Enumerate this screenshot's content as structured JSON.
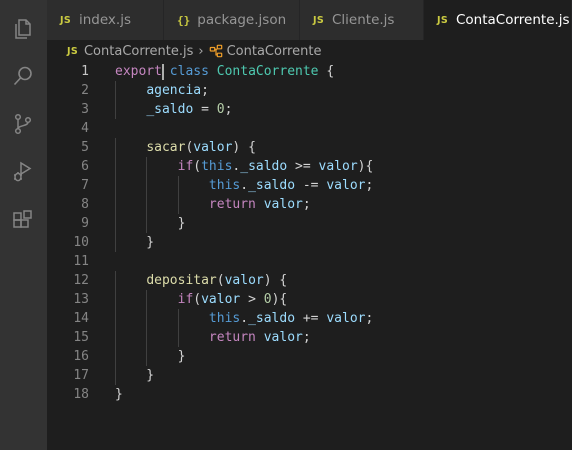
{
  "activity_bar": {
    "items": [
      {
        "icon": "explorer-icon"
      },
      {
        "icon": "search-icon"
      },
      {
        "icon": "source-control-icon"
      },
      {
        "icon": "run-debug-icon"
      },
      {
        "icon": "extensions-icon"
      }
    ]
  },
  "tabs": [
    {
      "label": "index.js",
      "badge": "JS",
      "active": false
    },
    {
      "label": "package.json",
      "badge": "{}",
      "active": false
    },
    {
      "label": "Cliente.js",
      "badge": "JS",
      "active": false
    },
    {
      "label": "ContaCorrente.js",
      "badge": "JS",
      "active": true,
      "close": "✕"
    }
  ],
  "breadcrumb": {
    "file_badge": "JS",
    "file": "ContaCorrente.js",
    "separator": "›",
    "symbol": "ContaCorrente"
  },
  "editor": {
    "current_line": 1,
    "line_numbers": [
      "1",
      "2",
      "3",
      "4",
      "5",
      "6",
      "7",
      "8",
      "9",
      "10",
      "11",
      "12",
      "13",
      "14",
      "15",
      "16",
      "17",
      "18"
    ],
    "lines": [
      [
        {
          "t": "kw",
          "v": "export"
        },
        {
          "t": "plain",
          "v": " "
        },
        {
          "t": "kw2",
          "v": "class"
        },
        {
          "t": "plain",
          "v": " "
        },
        {
          "t": "cls",
          "v": "ContaCorrente"
        },
        {
          "t": "plain",
          "v": " {"
        }
      ],
      [
        {
          "t": "plain",
          "v": "    "
        },
        {
          "t": "prop",
          "v": "agencia"
        },
        {
          "t": "plain",
          "v": ";"
        }
      ],
      [
        {
          "t": "plain",
          "v": "    "
        },
        {
          "t": "prop",
          "v": "_saldo"
        },
        {
          "t": "plain",
          "v": " = "
        },
        {
          "t": "num",
          "v": "0"
        },
        {
          "t": "plain",
          "v": ";"
        }
      ],
      [],
      [
        {
          "t": "plain",
          "v": "    "
        },
        {
          "t": "fn",
          "v": "sacar"
        },
        {
          "t": "plain",
          "v": "("
        },
        {
          "t": "prop",
          "v": "valor"
        },
        {
          "t": "plain",
          "v": ") {"
        }
      ],
      [
        {
          "t": "plain",
          "v": "        "
        },
        {
          "t": "kw",
          "v": "if"
        },
        {
          "t": "plain",
          "v": "("
        },
        {
          "t": "this",
          "v": "this"
        },
        {
          "t": "plain",
          "v": "."
        },
        {
          "t": "prop",
          "v": "_saldo"
        },
        {
          "t": "plain",
          "v": " >= "
        },
        {
          "t": "prop",
          "v": "valor"
        },
        {
          "t": "plain",
          "v": "){"
        }
      ],
      [
        {
          "t": "plain",
          "v": "            "
        },
        {
          "t": "this",
          "v": "this"
        },
        {
          "t": "plain",
          "v": "."
        },
        {
          "t": "prop",
          "v": "_saldo"
        },
        {
          "t": "plain",
          "v": " -= "
        },
        {
          "t": "prop",
          "v": "valor"
        },
        {
          "t": "plain",
          "v": ";"
        }
      ],
      [
        {
          "t": "plain",
          "v": "            "
        },
        {
          "t": "kw",
          "v": "return"
        },
        {
          "t": "plain",
          "v": " "
        },
        {
          "t": "prop",
          "v": "valor"
        },
        {
          "t": "plain",
          "v": ";"
        }
      ],
      [
        {
          "t": "plain",
          "v": "        }"
        }
      ],
      [
        {
          "t": "plain",
          "v": "    }"
        }
      ],
      [],
      [
        {
          "t": "plain",
          "v": "    "
        },
        {
          "t": "fn",
          "v": "depositar"
        },
        {
          "t": "plain",
          "v": "("
        },
        {
          "t": "prop",
          "v": "valor"
        },
        {
          "t": "plain",
          "v": ") {"
        }
      ],
      [
        {
          "t": "plain",
          "v": "        "
        },
        {
          "t": "kw",
          "v": "if"
        },
        {
          "t": "plain",
          "v": "("
        },
        {
          "t": "prop",
          "v": "valor"
        },
        {
          "t": "plain",
          "v": " > "
        },
        {
          "t": "num",
          "v": "0"
        },
        {
          "t": "plain",
          "v": "){"
        }
      ],
      [
        {
          "t": "plain",
          "v": "            "
        },
        {
          "t": "this",
          "v": "this"
        },
        {
          "t": "plain",
          "v": "."
        },
        {
          "t": "prop",
          "v": "_saldo"
        },
        {
          "t": "plain",
          "v": " += "
        },
        {
          "t": "prop",
          "v": "valor"
        },
        {
          "t": "plain",
          "v": ";"
        }
      ],
      [
        {
          "t": "plain",
          "v": "            "
        },
        {
          "t": "kw",
          "v": "return"
        },
        {
          "t": "plain",
          "v": " "
        },
        {
          "t": "prop",
          "v": "valor"
        },
        {
          "t": "plain",
          "v": ";"
        }
      ],
      [
        {
          "t": "plain",
          "v": "        }"
        }
      ],
      [
        {
          "t": "plain",
          "v": "    }"
        }
      ],
      [
        {
          "t": "plain",
          "v": "}"
        }
      ]
    ]
  },
  "colors": {
    "background": "#1e1e1e",
    "activity_bar": "#333333",
    "tab_inactive": "#2d2d2d",
    "js_badge": "#cbcb41"
  }
}
